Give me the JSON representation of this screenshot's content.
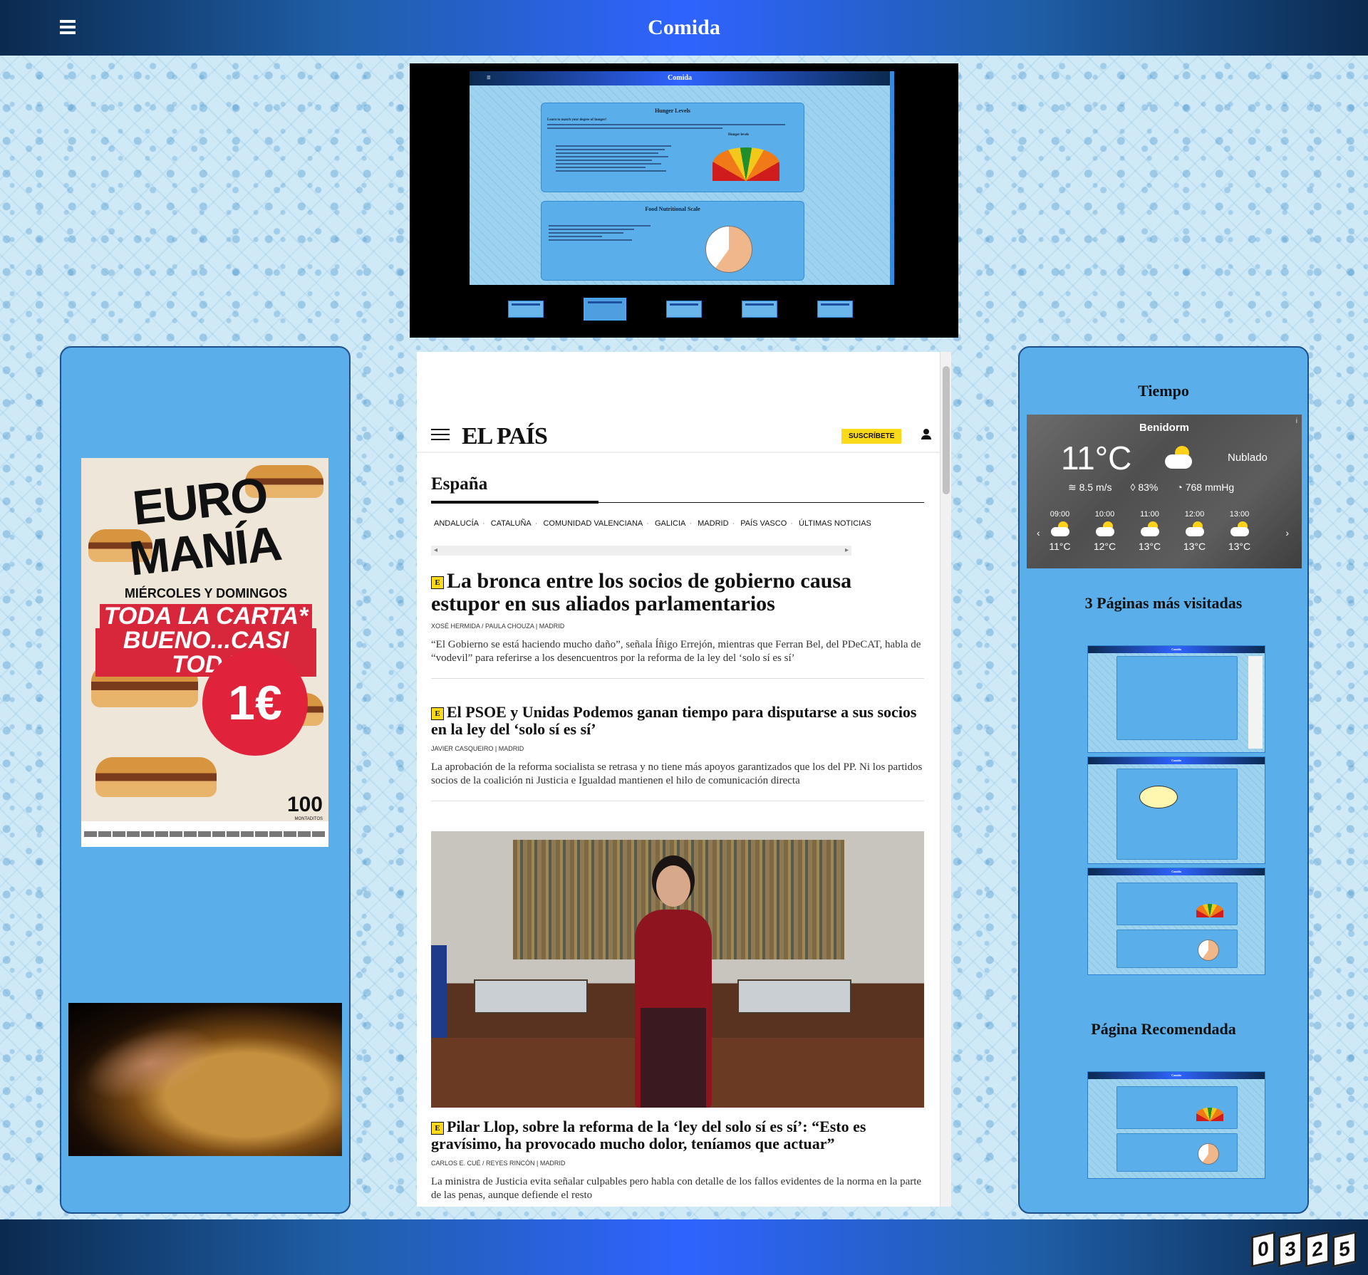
{
  "header": {
    "title": "Comida",
    "menu_icon": "hamburger-menu-icon"
  },
  "slideshow": {
    "slide_header": "Comida",
    "panels": [
      {
        "title": "Hunger Levels",
        "subtitle": "Learn to match your degree of hunger!",
        "gauge_label": "Hunger levels"
      },
      {
        "title": "Food Nutritional Scale"
      }
    ],
    "thumbnail_count": 5,
    "active_thumbnail": 1
  },
  "left_panel": {
    "ad": {
      "brand": "EURO MANÍA",
      "days": "MIÉRCOLES Y DOMINGOS",
      "offer_line1": "TODA LA CARTA*",
      "offer_line2": "BUENO...CASI TODA",
      "price": "1€",
      "count": "100",
      "count_sub": "MONTADITOS"
    }
  },
  "news": {
    "logo": "EL PAÍS",
    "subscribe_label": "SUSCRÍBETE",
    "section": "España",
    "subnav": [
      "ANDALUCÍA",
      "CATALUÑA",
      "COMUNIDAD VALENCIANA",
      "GALICIA",
      "MADRID",
      "PAÍS VASCO",
      "ÚLTIMAS NOTICIAS"
    ],
    "badge": "E",
    "articles": [
      {
        "headline": "La bronca entre los socios de gobierno causa estupor en sus aliados parlamentarios",
        "byline_authors": "XOSÉ HERMIDA / PAULA CHOUZA",
        "byline_place": "Madrid",
        "summary": "“El Gobierno se está haciendo mucho daño”, señala Íñigo Errejón, mientras que Ferran Bel, del PDeCAT, habla de “vodevil” para referirse a los desencuentros por la reforma de la ley del ‘solo sí es sí’"
      },
      {
        "headline": "El PSOE y Unidas Podemos ganan tiempo para disputarse a sus socios en la ley del ‘solo sí es sí’",
        "byline_authors": "JAVIER CASQUEIRO",
        "byline_place": "Madrid",
        "summary": "La aprobación de la reforma socialista se retrasa y no tiene más apoyos garantizados que los del PP. Ni los partidos socios de la coalición ni Justicia e Igualdad mantienen el hilo de comunicación directa"
      },
      {
        "headline": "Pilar Llop, sobre la reforma de la ‘ley del solo sí es sí’: “Esto es gravísimo, ha provocado mucho dolor, teníamos que actuar”",
        "byline_authors": "CARLOS E. CUÉ / REYES RINCÓN",
        "byline_place": "Madrid",
        "summary": "La ministra de Justicia evita señalar culpables pero habla con detalle de los fallos evidentes de la norma en la parte de las penas, aunque defiende el resto"
      }
    ]
  },
  "right_panel": {
    "weather_title": "Tiempo",
    "weather": {
      "city": "Benidorm",
      "temperature": "11°C",
      "condition": "Nublado",
      "wind": "8.5 m/s",
      "humidity": "83%",
      "pressure": "768 mmHg",
      "prev": "‹",
      "next": "›",
      "info": "i",
      "hours": [
        {
          "time": "09:00",
          "temp": "11°C"
        },
        {
          "time": "10:00",
          "temp": "12°C"
        },
        {
          "time": "11:00",
          "temp": "13°C"
        },
        {
          "time": "12:00",
          "temp": "13°C"
        },
        {
          "time": "13:00",
          "temp": "13°C"
        }
      ]
    },
    "top_pages_title": "3 Páginas más visitadas",
    "mini_page_header": "Comida",
    "recommended_title": "Página Recomendada"
  },
  "visit_counter": [
    "0",
    "3",
    "2",
    "5"
  ],
  "colors": {
    "header_gradient": [
      "#0b2a4f",
      "#2f63ff"
    ],
    "panel_bg": "#5aaeea",
    "subscribe_bg": "#ffda1a"
  }
}
